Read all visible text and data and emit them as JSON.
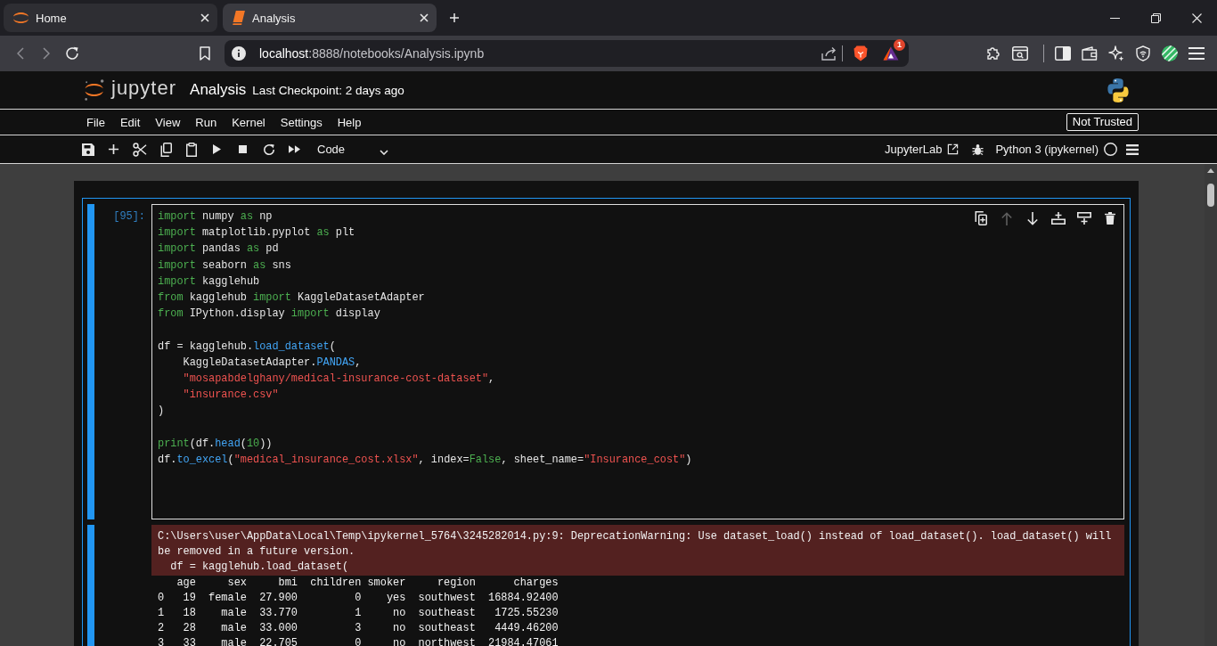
{
  "browser": {
    "tabs": [
      {
        "kind": "home",
        "title": "Home",
        "selected": false
      },
      {
        "kind": "notebook",
        "title": "Analysis",
        "selected": true
      }
    ],
    "address": {
      "host": "localhost",
      "path": ":8888/notebooks/Analysis.ipynb"
    },
    "rewards_badge": "1"
  },
  "jupyter": {
    "logo_text": "jupyter",
    "notebook_title": "Analysis",
    "checkpoint": "Last Checkpoint: 2 days ago",
    "menu": [
      "File",
      "Edit",
      "View",
      "Run",
      "Kernel",
      "Settings",
      "Help"
    ],
    "trust_button": "Not Trusted",
    "cell_type": "Code",
    "lab_link": "JupyterLab",
    "kernel": "Python 3 (ipykernel)"
  },
  "cells": [
    {
      "selected": true,
      "prompt": "[95]:",
      "actions": [
        {
          "kind": "duplicate",
          "disabled": false
        },
        {
          "kind": "move_up",
          "disabled": true
        },
        {
          "kind": "move_down",
          "disabled": false
        },
        {
          "kind": "insert_above",
          "disabled": false
        },
        {
          "kind": "insert_below",
          "disabled": false
        },
        {
          "kind": "delete",
          "disabled": false
        }
      ],
      "source": [
        {
          "lines": [
            {
              "tokens": [
                {
                  "kind": "keyword",
                  "text": "import"
                },
                {
                  "kind": "text",
                  "text": " numpy "
                },
                {
                  "kind": "keyword",
                  "text": "as"
                },
                {
                  "kind": "text",
                  "text": " np"
                }
              ]
            },
            {
              "tokens": [
                {
                  "kind": "keyword",
                  "text": "import"
                },
                {
                  "kind": "text",
                  "text": " matplotlib.pyplot "
                },
                {
                  "kind": "keyword",
                  "text": "as"
                },
                {
                  "kind": "text",
                  "text": " plt"
                }
              ]
            },
            {
              "tokens": [
                {
                  "kind": "keyword",
                  "text": "import"
                },
                {
                  "kind": "text",
                  "text": " pandas "
                },
                {
                  "kind": "keyword",
                  "text": "as"
                },
                {
                  "kind": "text",
                  "text": " pd"
                }
              ]
            },
            {
              "tokens": [
                {
                  "kind": "keyword",
                  "text": "import"
                },
                {
                  "kind": "text",
                  "text": " seaborn "
                },
                {
                  "kind": "keyword",
                  "text": "as"
                },
                {
                  "kind": "text",
                  "text": " sns"
                }
              ]
            },
            {
              "tokens": [
                {
                  "kind": "keyword",
                  "text": "import"
                },
                {
                  "kind": "text",
                  "text": " kagglehub"
                }
              ]
            },
            {
              "tokens": [
                {
                  "kind": "keyword",
                  "text": "from"
                },
                {
                  "kind": "text",
                  "text": " kagglehub "
                },
                {
                  "kind": "keyword",
                  "text": "import"
                },
                {
                  "kind": "text",
                  "text": " KaggleDatasetAdapter"
                }
              ]
            },
            {
              "tokens": [
                {
                  "kind": "keyword",
                  "text": "from"
                },
                {
                  "kind": "text",
                  "text": " IPython.display "
                },
                {
                  "kind": "keyword",
                  "text": "import"
                },
                {
                  "kind": "text",
                  "text": " display"
                }
              ]
            }
          ]
        },
        {
          "lines": [
            {
              "tokens": [
                {
                  "kind": "text",
                  "text": "df = kagglehub."
                },
                {
                  "kind": "property",
                  "text": "load_dataset"
                },
                {
                  "kind": "text",
                  "text": "("
                }
              ]
            },
            {
              "tokens": [
                {
                  "kind": "text",
                  "text": "    KaggleDatasetAdapter."
                },
                {
                  "kind": "property",
                  "text": "PANDAS"
                },
                {
                  "kind": "text",
                  "text": ","
                }
              ]
            },
            {
              "tokens": [
                {
                  "kind": "string",
                  "text": "    \"mosapabdelghany/medical-insurance-cost-dataset\""
                },
                {
                  "kind": "text",
                  "text": ","
                }
              ]
            },
            {
              "tokens": [
                {
                  "kind": "string",
                  "text": "    \"insurance.csv\""
                }
              ]
            },
            {
              "tokens": [
                {
                  "kind": "text",
                  "text": ")"
                }
              ]
            }
          ]
        },
        {
          "lines": [
            {
              "tokens": [
                {
                  "kind": "builtin",
                  "text": "print"
                },
                {
                  "kind": "text",
                  "text": "(df."
                },
                {
                  "kind": "property",
                  "text": "head"
                },
                {
                  "kind": "text",
                  "text": "("
                },
                {
                  "kind": "number",
                  "text": "10"
                },
                {
                  "kind": "text",
                  "text": "))"
                }
              ]
            },
            {
              "tokens": [
                {
                  "kind": "text",
                  "text": "df."
                },
                {
                  "kind": "property",
                  "text": "to_excel"
                },
                {
                  "kind": "text",
                  "text": "("
                },
                {
                  "kind": "string",
                  "text": "\"medical_insurance_cost.xlsx\""
                },
                {
                  "kind": "text",
                  "text": ", index="
                },
                {
                  "kind": "keyword",
                  "text": "False"
                },
                {
                  "kind": "text",
                  "text": ", sheet_name="
                },
                {
                  "kind": "string",
                  "text": "\"Insurance_cost\""
                },
                {
                  "kind": "text",
                  "text": ")"
                }
              ]
            }
          ]
        }
      ],
      "outputs": [
        {
          "kind": "stderr",
          "lines": [
            "C:\\Users\\user\\AppData\\Local\\Temp\\ipykernel_5764\\3245282014.py:9: DeprecationWarning: Use dataset_load() instead of load_dataset(). load_dataset() will",
            "be removed in a future version.",
            "  df = kagglehub.load_dataset("
          ]
        },
        {
          "kind": "stdout",
          "lines": [
            "   age     sex     bmi  children smoker     region      charges",
            "0   19  female  27.900         0    yes  southwest  16884.92400",
            "1   18    male  33.770         1     no  southeast   1725.55230",
            "2   28    male  33.000         3     no  southeast   4449.46200",
            "3   33    male  22.705         0     no  northwest  21984.47061"
          ]
        }
      ]
    }
  ]
}
